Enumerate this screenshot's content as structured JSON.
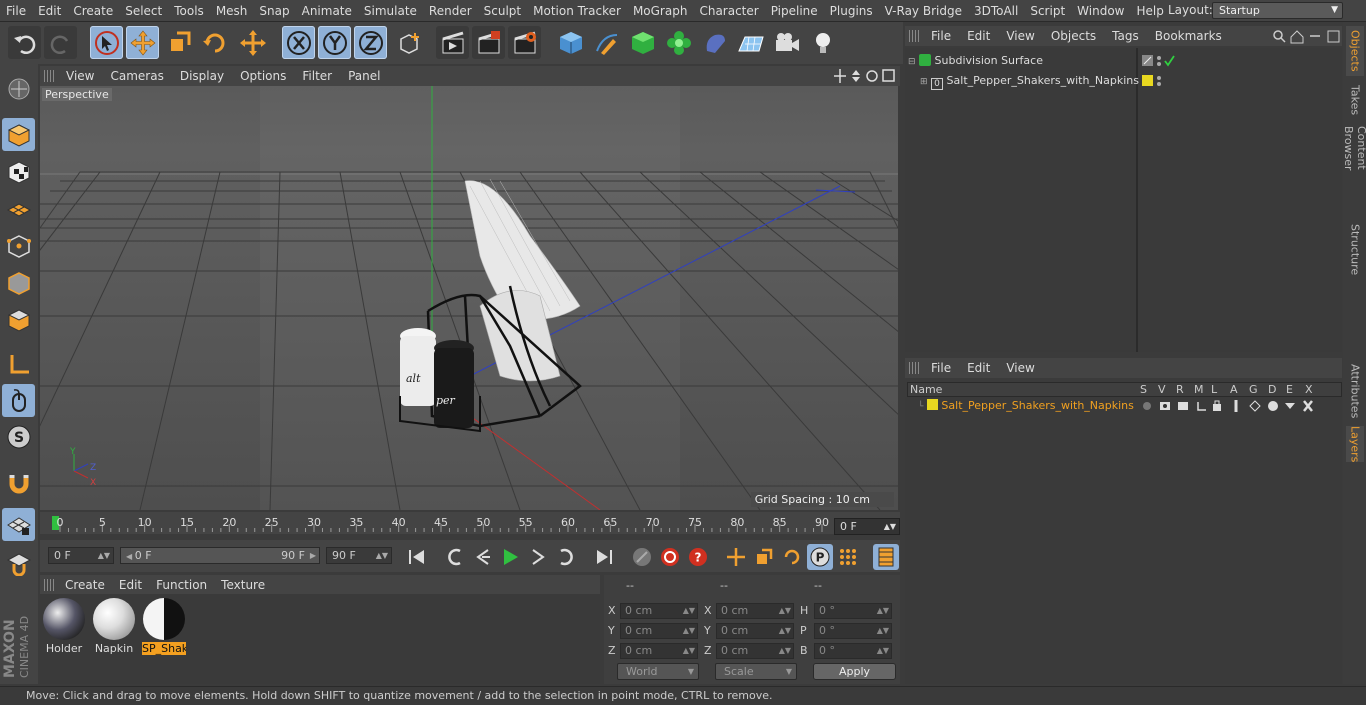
{
  "menu": [
    "File",
    "Edit",
    "Create",
    "Select",
    "Tools",
    "Mesh",
    "Snap",
    "Animate",
    "Simulate",
    "Render",
    "Sculpt",
    "Motion Tracker",
    "MoGraph",
    "Character",
    "Pipeline",
    "Plugins",
    "V-Ray Bridge",
    "3DToAll",
    "Script",
    "Window",
    "Help"
  ],
  "layout": {
    "label": "Layout:",
    "value": "Startup"
  },
  "viewport": {
    "menu": [
      "View",
      "Cameras",
      "Display",
      "Options",
      "Filter",
      "Panel"
    ],
    "label": "Perspective",
    "grid_spacing": "Grid Spacing : 10 cm",
    "axis": {
      "x": "X",
      "y": "Y",
      "z": "Z"
    }
  },
  "timeline": {
    "ticks": [
      "0",
      "5",
      "10",
      "15",
      "20",
      "25",
      "30",
      "35",
      "40",
      "45",
      "50",
      "55",
      "60",
      "65",
      "70",
      "75",
      "80",
      "85",
      "90"
    ],
    "current": "0 F"
  },
  "transport": {
    "start": "0 F",
    "range_start": "0 F",
    "range_end": "90 F",
    "end": "90 F"
  },
  "materials": {
    "menu": [
      "Create",
      "Edit",
      "Function",
      "Texture"
    ],
    "items": [
      {
        "name": "Holder",
        "selected": false
      },
      {
        "name": "Napkin",
        "selected": false
      },
      {
        "name": "SP_Shak",
        "selected": true
      }
    ]
  },
  "coordinates": {
    "headers": [
      "--",
      "--",
      "--"
    ],
    "rows": [
      {
        "l1": "X",
        "v1": "0 cm",
        "l2": "X",
        "v2": "0 cm",
        "l3": "H",
        "v3": "0 °"
      },
      {
        "l1": "Y",
        "v1": "0 cm",
        "l2": "Y",
        "v2": "0 cm",
        "l3": "P",
        "v3": "0 °"
      },
      {
        "l1": "Z",
        "v1": "0 cm",
        "l2": "Z",
        "v2": "0 cm",
        "l3": "B",
        "v3": "0 °"
      }
    ],
    "mode": "World",
    "transform": "Scale",
    "apply": "Apply"
  },
  "status": "Move: Click and drag to move elements. Hold down SHIFT to quantize movement / add to the selection in point mode, CTRL to remove.",
  "objects": {
    "menu": [
      "File",
      "Edit",
      "View",
      "Objects",
      "Tags",
      "Bookmarks"
    ],
    "items": [
      {
        "name": "Subdivision Surface"
      },
      {
        "name": "Salt_Pepper_Shakers_with_Napkins",
        "color": "#e8d820"
      }
    ]
  },
  "layers": {
    "menu": [
      "File",
      "Edit",
      "View"
    ],
    "columns": [
      "Name",
      "S",
      "V",
      "R",
      "M",
      "L",
      "A",
      "G",
      "D",
      "E",
      "X"
    ],
    "items": [
      {
        "name": "Salt_Pepper_Shakers_with_Napkins",
        "color": "#e8d820"
      }
    ]
  },
  "right_tabs": [
    "Objects",
    "Takes",
    "Content Browser",
    "Structure",
    "Attributes",
    "Layers"
  ],
  "colors": {
    "accent": "#8fb0d6",
    "selected": "#f4a020",
    "layer_text": "#f0a020"
  }
}
